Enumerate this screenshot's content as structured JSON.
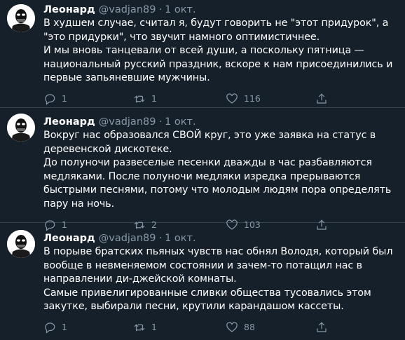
{
  "tweets": [
    {
      "name": "Леонард",
      "handle": "@vadjan89",
      "sep": "·",
      "date": "1 окт.",
      "paragraphs": [
        "В худшем случае, считал я, будут говорить не \"этот придурок\", а \"это придурки\", что звучит намного оптимистичнее.",
        "И мы вновь танцевали от всей души, а поскольку пятница — национальный русский праздник, вскоре к нам присоединились и первые запьяневшие мужчины."
      ],
      "replies": "1",
      "retweets": "1",
      "likes": "116"
    },
    {
      "name": "Леонард",
      "handle": "@vadjan89",
      "sep": "·",
      "date": "1 окт.",
      "paragraphs": [
        "Вокруг нас образовался СВОЙ круг, это уже заявка на статус в деревенской дискотеке.",
        "До полуночи развеселые песенки дважды в час разбавляются медляками. После полуночи медляки изредка прерываются быстрыми песнями, потому что молодым людям пора определять пару на ночь."
      ],
      "replies": "1",
      "retweets": "2",
      "likes": "103"
    },
    {
      "name": "Леонард",
      "handle": "@vadjan89",
      "sep": "·",
      "date": "1 окт.",
      "paragraphs": [
        "В порыве братских пьяных чувств нас обнял Володя, который был вообще в невменяемом состоянии и зачем-то потащил нас в направлении ди-джейской комнаты.",
        "Самые привелигированные сливки общества тусовались этом закутке, выбирали песни, крутили карандашом кассеты."
      ],
      "replies": "1",
      "retweets": "1",
      "likes": "88"
    }
  ],
  "icons": {
    "reply": "reply-icon",
    "retweet": "retweet-icon",
    "like": "heart-icon",
    "avatar": "masked-figure-avatar"
  },
  "colors": {
    "background": "#15202b",
    "text": "#ffffff",
    "secondary": "#8899a6",
    "divider": "#38444d"
  }
}
